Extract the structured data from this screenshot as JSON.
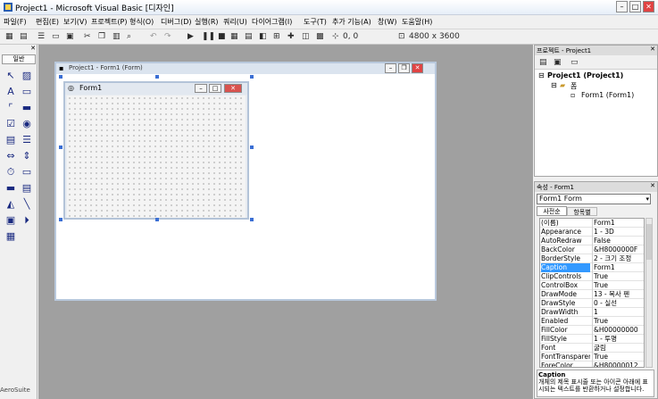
{
  "window": {
    "title": "Project1 - Microsoft Visual Basic [디자인]",
    "min": "–",
    "max": "□",
    "close": "✕"
  },
  "menu": [
    "파일(F)",
    "편집(E)",
    "보기(V)",
    "프로젝트(P)",
    "형식(O)",
    "디버그(D)",
    "실행(R)",
    "쿼리(U)",
    "다이어그램(I)",
    "도구(T)",
    "추가 기능(A)",
    "창(W)",
    "도움말(H)"
  ],
  "toolbar": {
    "position": "0, 0",
    "size": "4800 x 3600"
  },
  "toolbox": {
    "tab": "일반",
    "status": "AeroSuite"
  },
  "designer": {
    "outer_title": "Project1 - Form1 (Form)",
    "form_title": "Form1"
  },
  "project": {
    "title": "프로젝트 - Project1",
    "root": "Project1 (Project1)",
    "folder": "폼",
    "item": "Form1 (Form1)"
  },
  "properties": {
    "title": "속성 - Form1",
    "object": "Form1 Form",
    "tab_alpha": "사전순",
    "tab_cat": "항목별",
    "rows": [
      {
        "name": "(이름)",
        "value": "Form1"
      },
      {
        "name": "Appearance",
        "value": "1 - 3D"
      },
      {
        "name": "AutoRedraw",
        "value": "False"
      },
      {
        "name": "BackColor",
        "value": "&H8000000F"
      },
      {
        "name": "BorderStyle",
        "value": "2 - 크기 조정"
      },
      {
        "name": "Caption",
        "value": "Form1"
      },
      {
        "name": "ClipControls",
        "value": "True"
      },
      {
        "name": "ControlBox",
        "value": "True"
      },
      {
        "name": "DrawMode",
        "value": "13 - 복사 펜"
      },
      {
        "name": "DrawStyle",
        "value": "0 - 실선"
      },
      {
        "name": "DrawWidth",
        "value": "1"
      },
      {
        "name": "Enabled",
        "value": "True"
      },
      {
        "name": "FillColor",
        "value": "&H00000000"
      },
      {
        "name": "FillStyle",
        "value": "1 - 투명"
      },
      {
        "name": "Font",
        "value": "굴림"
      },
      {
        "name": "FontTransparent",
        "value": "True"
      },
      {
        "name": "ForeColor",
        "value": "&H80000012"
      }
    ],
    "selected_index": 5,
    "desc_title": "Caption",
    "desc_text": "개체의 제목 표시줄 또는 아이콘 아래에 표시되는 텍스트를 반환하거나 설정합니다."
  }
}
